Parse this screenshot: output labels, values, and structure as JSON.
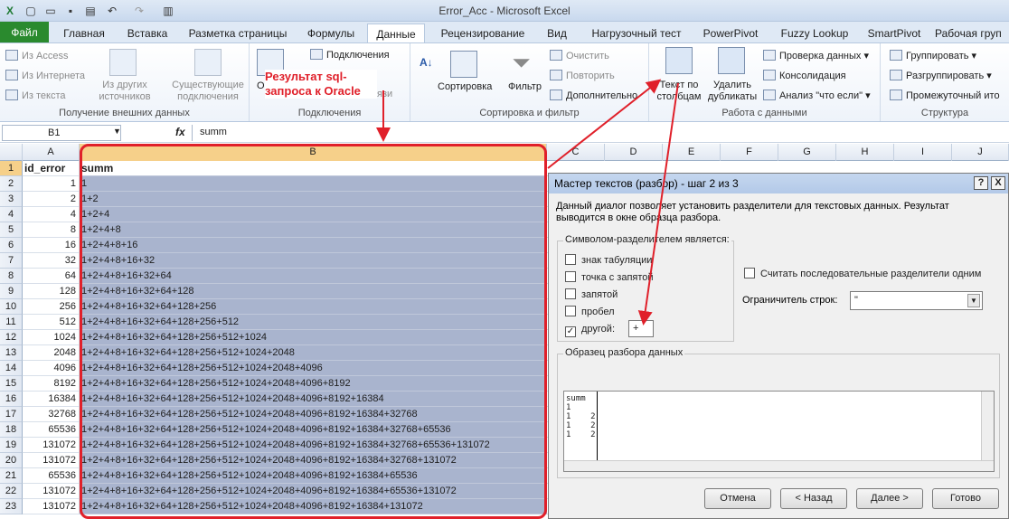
{
  "window": {
    "title": "Error_Acc  -  Microsoft Excel"
  },
  "tabs": [
    "Файл",
    "Главная",
    "Вставка",
    "Разметка страницы",
    "Формулы",
    "Данные",
    "Рецензирование",
    "Вид",
    "Нагрузочный тест",
    "PowerPivot",
    "Fuzzy Lookup",
    "SmartPivot",
    "Рабочая груп"
  ],
  "ribbon": {
    "g1": {
      "items": [
        "Из Access",
        "Из Интернета",
        "Из текста"
      ],
      "other": "Из других источников",
      "existing": "Существующие подключения",
      "label": "Получение внешних данных"
    },
    "g2": {
      "connections": "Подключения",
      "refresh_short": "Об",
      "links_tail": "язи",
      "label": "Подключения"
    },
    "g3": {
      "sort": "Сортировка",
      "filter": "Фильтр",
      "clear": "Очистить",
      "reapply": "Повторить",
      "advanced": "Дополнительно",
      "label": "Сортировка и фильтр"
    },
    "g4": {
      "text_to_cols": "Текст по столбцам",
      "remove_dup": "Удалить дубликаты",
      "validation": "Проверка данных",
      "consolidate": "Консолидация",
      "whatif": "Анализ \"что если\"",
      "label": "Работа с данными"
    },
    "g5": {
      "group": "Группировать",
      "ungroup": "Разгруппировать",
      "subtotal": "Промежуточный ито",
      "label": "Структура"
    }
  },
  "annotation": "Результат sql-запроса к Oracle",
  "formula_bar": {
    "name_box": "B1",
    "fx": "fx",
    "value": "summ"
  },
  "columns": [
    "A",
    "B",
    "C",
    "D",
    "E",
    "F",
    "G",
    "H",
    "I",
    "J"
  ],
  "header_row": {
    "a": "id_error",
    "b": "summ"
  },
  "rows": [
    {
      "n": "2",
      "a": "1",
      "b": "1"
    },
    {
      "n": "3",
      "a": "2",
      "b": "1+2"
    },
    {
      "n": "4",
      "a": "4",
      "b": "1+2+4"
    },
    {
      "n": "5",
      "a": "8",
      "b": "1+2+4+8"
    },
    {
      "n": "6",
      "a": "16",
      "b": "1+2+4+8+16"
    },
    {
      "n": "7",
      "a": "32",
      "b": "1+2+4+8+16+32"
    },
    {
      "n": "8",
      "a": "64",
      "b": "1+2+4+8+16+32+64"
    },
    {
      "n": "9",
      "a": "128",
      "b": "1+2+4+8+16+32+64+128"
    },
    {
      "n": "10",
      "a": "256",
      "b": "1+2+4+8+16+32+64+128+256"
    },
    {
      "n": "11",
      "a": "512",
      "b": "1+2+4+8+16+32+64+128+256+512"
    },
    {
      "n": "12",
      "a": "1024",
      "b": "1+2+4+8+16+32+64+128+256+512+1024"
    },
    {
      "n": "13",
      "a": "2048",
      "b": "1+2+4+8+16+32+64+128+256+512+1024+2048"
    },
    {
      "n": "14",
      "a": "4096",
      "b": "1+2+4+8+16+32+64+128+256+512+1024+2048+4096"
    },
    {
      "n": "15",
      "a": "8192",
      "b": "1+2+4+8+16+32+64+128+256+512+1024+2048+4096+8192"
    },
    {
      "n": "16",
      "a": "16384",
      "b": "1+2+4+8+16+32+64+128+256+512+1024+2048+4096+8192+16384"
    },
    {
      "n": "17",
      "a": "32768",
      "b": "1+2+4+8+16+32+64+128+256+512+1024+2048+4096+8192+16384+32768"
    },
    {
      "n": "18",
      "a": "65536",
      "b": "1+2+4+8+16+32+64+128+256+512+1024+2048+4096+8192+16384+32768+65536"
    },
    {
      "n": "19",
      "a": "131072",
      "b": "1+2+4+8+16+32+64+128+256+512+1024+2048+4096+8192+16384+32768+65536+131072"
    },
    {
      "n": "20",
      "a": "131072",
      "b": "1+2+4+8+16+32+64+128+256+512+1024+2048+4096+8192+16384+32768+131072"
    },
    {
      "n": "21",
      "a": "65536",
      "b": "1+2+4+8+16+32+64+128+256+512+1024+2048+4096+8192+16384+65536"
    },
    {
      "n": "22",
      "a": "131072",
      "b": "1+2+4+8+16+32+64+128+256+512+1024+2048+4096+8192+16384+65536+131072"
    },
    {
      "n": "23",
      "a": "131072",
      "b": "1+2+4+8+16+32+64+128+256+512+1024+2048+4096+8192+16384+131072"
    }
  ],
  "dialog": {
    "title": "Мастер текстов (разбор) - шаг 2 из 3",
    "help": "?",
    "close": "X",
    "desc1": "Данный диалог позволяет установить разделители для текстовых данных. Результат",
    "desc2": "выводится в окне образца разбора.",
    "delim_group": "Символом-разделителем является:",
    "tab": "знак табуляции",
    "semicolon": "точка с запятой",
    "comma": "запятой",
    "space": "пробел",
    "other": "другой:",
    "other_value": "+",
    "consecutive": "Считать последовательные разделители одним",
    "qualifier_label": "Ограничитель строк:",
    "qualifier_value": "\"",
    "preview_label": "Образец разбора данных",
    "preview_lines": [
      "summ",
      "1",
      "1    2",
      "1    2",
      "1    2"
    ],
    "btn_cancel": "Отмена",
    "btn_back": "< Назад",
    "btn_next": "Далее >",
    "btn_finish": "Готово"
  }
}
